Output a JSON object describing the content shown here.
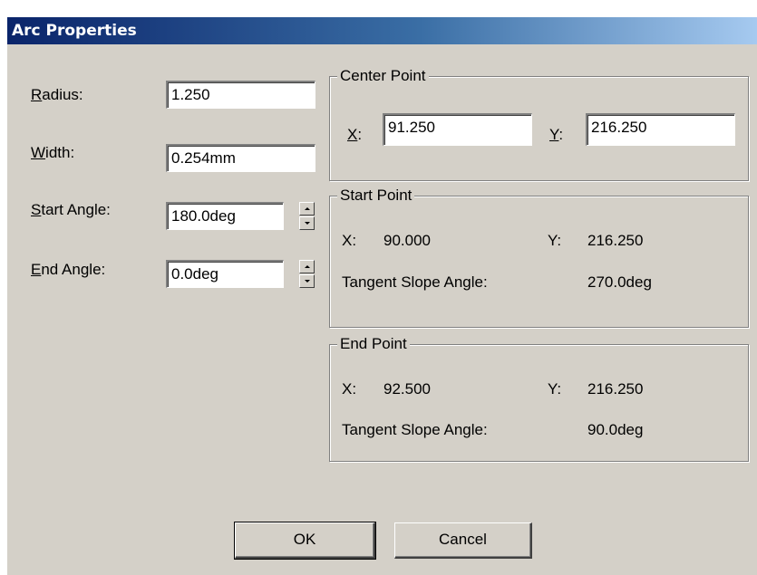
{
  "window": {
    "title": "Arc Properties"
  },
  "fields": {
    "radius": {
      "label_accel": "R",
      "label_rest": "adius:",
      "value": "1.250"
    },
    "width": {
      "label_accel": "W",
      "label_rest": "idth:",
      "value": "0.254mm"
    },
    "start_angle": {
      "label_accel": "S",
      "label_rest": "tart Angle:",
      "value": "180.0deg"
    },
    "end_angle": {
      "label_accel": "E",
      "label_rest": "nd Angle:",
      "value": "0.0deg"
    }
  },
  "center_point": {
    "title": "Center Point",
    "x_label_accel": "X",
    "x_label_rest": ":",
    "x_value": "91.250",
    "y_label_accel": "Y",
    "y_label_rest": ":",
    "y_value": "216.250"
  },
  "start_point": {
    "title": "Start Point",
    "x_label": "X:",
    "x_value": "90.000",
    "y_label": "Y:",
    "y_value": "216.250",
    "tangent_label": "Tangent Slope Angle:",
    "tangent_value": "270.0deg"
  },
  "end_point": {
    "title": "End Point",
    "x_label": "X:",
    "x_value": "92.500",
    "y_label": "Y:",
    "y_value": "216.250",
    "tangent_label": "Tangent Slope Angle:",
    "tangent_value": "90.0deg"
  },
  "buttons": {
    "ok": "OK",
    "cancel": "Cancel"
  },
  "colors": {
    "title_gradient_start": "#0a246a",
    "title_gradient_end": "#a6caf0",
    "face": "#d4d0c8"
  }
}
